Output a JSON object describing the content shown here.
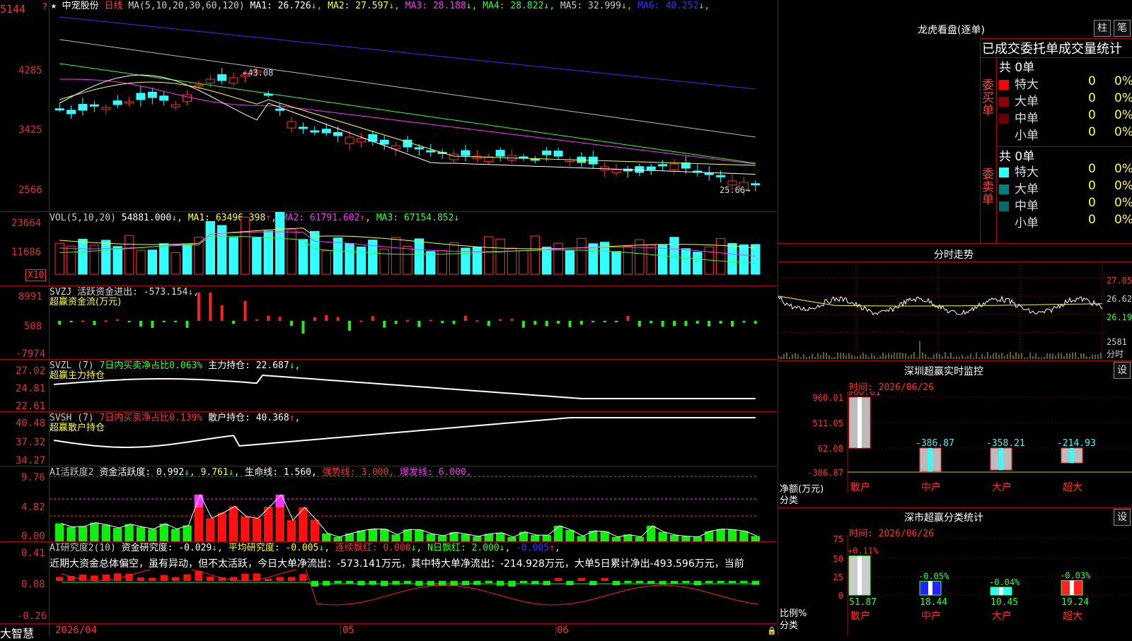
{
  "stock": {
    "name": "中宠股份",
    "period": "日线",
    "ma_header": "MA(5,10,20,30,60,120)",
    "ma_values": [
      {
        "label": "MA1:",
        "value": "26.726",
        "arrow": "↓",
        "color": "#ffffff"
      },
      {
        "label": "MA2:",
        "value": "27.597",
        "arrow": "↓",
        "color": "#ffff33"
      },
      {
        "label": "MA3:",
        "value": "28.188",
        "arrow": "↓",
        "color": "#ff33ff"
      },
      {
        "label": "MA4:",
        "value": "28.822",
        "arrow": "↓",
        "color": "#33ff33"
      },
      {
        "label": "MA5:",
        "value": "32.999",
        "arrow": "↓",
        "color": "#cccccc"
      },
      {
        "label": "MA6:",
        "value": "40.252",
        "arrow": "↓",
        "color": "#3333ff"
      }
    ],
    "price_axis": [
      "5144",
      "4285",
      "3425",
      "2566"
    ],
    "high_label": "43.08",
    "low_label": "25.66"
  },
  "vol": {
    "header": "VOL(5,10,20)",
    "value": "54881.000",
    "ma1": "63496.398",
    "ma2": "61791.602",
    "ma3": "67154.852",
    "axis": [
      "23664",
      "11686"
    ],
    "unit": "X10"
  },
  "svzj": {
    "header": "SVZJ  活跃资金进出: -573.154",
    "sub": "超赢资金流(万元)",
    "axis": [
      "8991",
      "508",
      "-7974"
    ]
  },
  "svzl": {
    "header": "SVZL (7)",
    "ratio": "7日内买卖净占比0.063%",
    "hold": "主力持仓: 22.687",
    "sub": "超赢主力持仓",
    "axis": [
      "27.02",
      "24.81",
      "22.61"
    ]
  },
  "svsh": {
    "header": "SVSH (7)",
    "ratio": "7日内买卖净占比0.139%",
    "hold": "散户持仓: 40.368",
    "sub": "超赢散户持仓",
    "axis": [
      "40.48",
      "37.32",
      "34.27"
    ]
  },
  "ai2": {
    "header": "AI活跃度2",
    "a": "资金活跃度: 0.992",
    "b": "9.761",
    "c": "生命线: 1.560,",
    "d": "强势线: 3.000,",
    "e": "爆发线: 6.000,",
    "axis": [
      "9.76",
      "4.82",
      "0.00"
    ]
  },
  "research": {
    "header": "AI研究度2(10)",
    "a": "资金研究度: -0.029",
    "b": "平均研究度: -0.005",
    "c": "连续飘红: 0.000",
    "d": "N日飘红: 2.000",
    "e": "-0.005",
    "note": "近期大资金总体偏空，虽有异动，但不太活跃，今日大单净流出：-573.141万元，其中特大单净流出：-214.928万元，大单5日累计净出-493.596万元，当前",
    "axis": [
      "0.41",
      "0.08",
      "-0.26"
    ]
  },
  "xaxis": [
    "2026/04",
    "05",
    "06"
  ],
  "bottom_left": "大智慧",
  "right": {
    "title": "龙虎看盘(逐单)",
    "btn1": "柱",
    "btn2": "笔",
    "subtitle": "已成交委托单成交量统计",
    "buy_side": "委买单",
    "sell_side": "委卖单",
    "buy_total": "共 0单",
    "sell_total": "共 0单",
    "rows": [
      {
        "label": "特大",
        "count": "0",
        "pct": "0%"
      },
      {
        "label": "大单",
        "count": "0",
        "pct": "0%"
      },
      {
        "label": "中单",
        "count": "0",
        "pct": "0%"
      },
      {
        "label": "小单",
        "count": "0",
        "pct": "0%"
      }
    ],
    "buy_colors": [
      "#ff0000",
      "#8b0000",
      "#6b0000",
      "#000000"
    ],
    "sell_colors": [
      "#33ffff",
      "#008080",
      "#006a6a",
      "#000000"
    ],
    "intraday_title": "分时走势",
    "intraday_axis": [
      "27.05",
      "26.62",
      "26.19",
      "2581",
      "分时"
    ],
    "monitor_title": "深圳超赢实时监控",
    "monitor_btn": "设",
    "monitor_time": "时间: 2026/06/26",
    "monitor_axis": [
      "960.01",
      "511.05",
      "62.08",
      "-386.87"
    ],
    "monitor_ylabel": "净额(万元)",
    "monitor_xlabel": "分类",
    "monitor_bars": [
      {
        "cat": "散户",
        "value": "960.01"
      },
      {
        "cat": "中户",
        "value": "-386.87"
      },
      {
        "cat": "大户",
        "value": "-358.21"
      },
      {
        "cat": "超大",
        "value": "-214.93"
      }
    ],
    "stat_title": "深市超赢分类统计",
    "stat_btn": "设",
    "stat_time": "时间: 2026/06/26",
    "stat_axis": [
      "75",
      "50",
      "25",
      "0"
    ],
    "stat_ylabel": "比例%",
    "stat_xlabel": "分类",
    "stat_bars": [
      {
        "cat": "散户",
        "top": "+0.11%",
        "bottom": "51.87",
        "color": "#cccccc"
      },
      {
        "cat": "中户",
        "top": "-0.05%",
        "bottom": "18.44",
        "color": "#2222ff"
      },
      {
        "cat": "大户",
        "top": "-0.04%",
        "bottom": "10.45",
        "color": "#33ffff"
      },
      {
        "cat": "超大",
        "top": "-0.03%",
        "bottom": "19.24",
        "color": "#ff2222"
      }
    ]
  }
}
